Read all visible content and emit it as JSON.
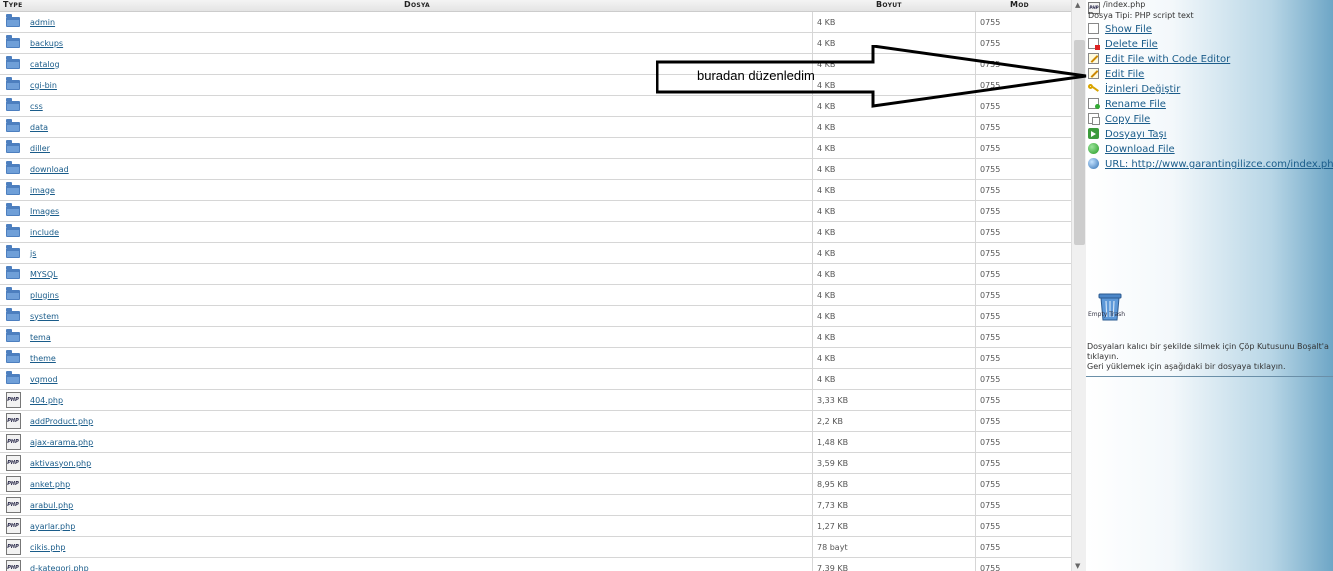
{
  "columns": {
    "type": "Type",
    "file": "Dosya",
    "size": "Boyut",
    "mode": "Mod"
  },
  "files": [
    {
      "icon": "folder-icon",
      "name": "admin",
      "size": "4 KB",
      "mode": "0755"
    },
    {
      "icon": "folder-icon",
      "name": "backups",
      "size": "4 KB",
      "mode": "0755"
    },
    {
      "icon": "folder-icon",
      "name": "catalog",
      "size": "4 KB",
      "mode": "0755"
    },
    {
      "icon": "folder-icon",
      "name": "cgi-bin",
      "size": "4 KB",
      "mode": "0755"
    },
    {
      "icon": "folder-icon",
      "name": "css",
      "size": "4 KB",
      "mode": "0755"
    },
    {
      "icon": "folder-icon",
      "name": "data",
      "size": "4 KB",
      "mode": "0755"
    },
    {
      "icon": "folder-icon",
      "name": "diller",
      "size": "4 KB",
      "mode": "0755"
    },
    {
      "icon": "folder-icon",
      "name": "download",
      "size": "4 KB",
      "mode": "0755"
    },
    {
      "icon": "folder-icon",
      "name": "image",
      "size": "4 KB",
      "mode": "0755"
    },
    {
      "icon": "folder-icon",
      "name": "Images",
      "size": "4 KB",
      "mode": "0755"
    },
    {
      "icon": "folder-icon",
      "name": "include",
      "size": "4 KB",
      "mode": "0755"
    },
    {
      "icon": "folder-icon",
      "name": "js",
      "size": "4 KB",
      "mode": "0755"
    },
    {
      "icon": "folder-icon",
      "name": "MYSQL",
      "size": "4 KB",
      "mode": "0755"
    },
    {
      "icon": "folder-icon",
      "name": "plugins",
      "size": "4 KB",
      "mode": "0755"
    },
    {
      "icon": "folder-icon",
      "name": "system",
      "size": "4 KB",
      "mode": "0755"
    },
    {
      "icon": "folder-icon",
      "name": "tema",
      "size": "4 KB",
      "mode": "0755"
    },
    {
      "icon": "folder-icon",
      "name": "theme",
      "size": "4 KB",
      "mode": "0755"
    },
    {
      "icon": "folder-icon",
      "name": "vqmod",
      "size": "4 KB",
      "mode": "0755"
    },
    {
      "icon": "php-file-icon",
      "name": "404.php",
      "size": "3,33 KB",
      "mode": "0755"
    },
    {
      "icon": "php-file-icon",
      "name": "addProduct.php",
      "size": "2,2 KB",
      "mode": "0755"
    },
    {
      "icon": "php-file-icon",
      "name": "ajax-arama.php",
      "size": "1,48 KB",
      "mode": "0755"
    },
    {
      "icon": "php-file-icon",
      "name": "aktivasyon.php",
      "size": "3,59 KB",
      "mode": "0755"
    },
    {
      "icon": "php-file-icon",
      "name": "anket.php",
      "size": "8,95 KB",
      "mode": "0755"
    },
    {
      "icon": "php-file-icon",
      "name": "arabul.php",
      "size": "7,73 KB",
      "mode": "0755"
    },
    {
      "icon": "php-file-icon",
      "name": "ayarlar.php",
      "size": "1,27 KB",
      "mode": "0755"
    },
    {
      "icon": "php-file-icon",
      "name": "cikis.php",
      "size": "78 bayt",
      "mode": "0755"
    },
    {
      "icon": "php-file-icon",
      "name": "d-kategori.php",
      "size": "7,39 KB",
      "mode": "0755"
    }
  ],
  "panel": {
    "path": "/index.php",
    "file_type": "Dosya Tipi: PHP script text",
    "php_badge": "PHP",
    "actions": [
      {
        "icon": "page-icon",
        "label": "Show File"
      },
      {
        "icon": "delete-file-icon",
        "label": "Delete File"
      },
      {
        "icon": "edit-pencil-icon",
        "label": "Edit File with Code Editor"
      },
      {
        "icon": "edit-pencil-icon",
        "label": "Edit File"
      },
      {
        "icon": "key-icon",
        "label": "İzinleri Değiştir"
      },
      {
        "icon": "rename-icon",
        "label": "Rename File"
      },
      {
        "icon": "copy-icon",
        "label": "Copy File"
      },
      {
        "icon": "move-icon",
        "label": "Dosyayı Taşı"
      },
      {
        "icon": "download-icon",
        "label": "Download File"
      },
      {
        "icon": "globe-icon",
        "label": "URL: http://www.garantingilizce.com/index.php"
      }
    ],
    "trash_label": "Empty Trash",
    "note_line1": "Dosyaları kalıcı bir şekilde silmek için Çöp Kutusunu Boşalt'a tıklayın.",
    "note_line2": "Geri yüklemek için aşağıdaki bir dosyaya tıklayın."
  },
  "annotation": {
    "text": "buradan düzenledim"
  }
}
